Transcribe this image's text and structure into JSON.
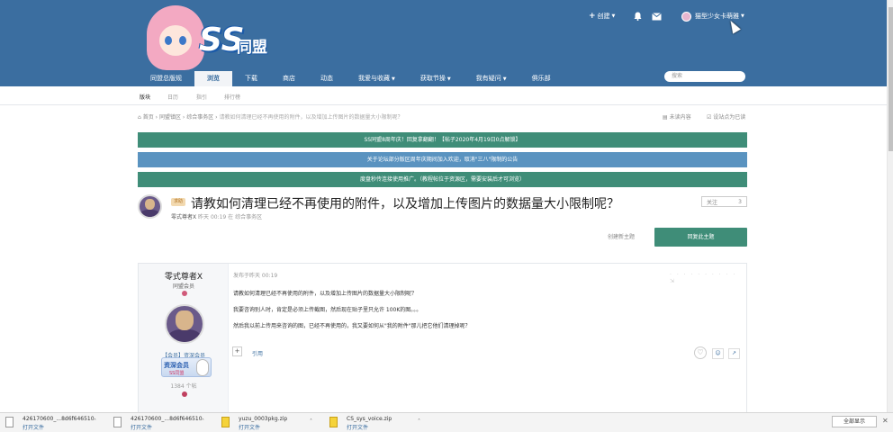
{
  "header": {
    "site_logo_text": "SS同盟",
    "create_label": "创建",
    "username": "猫型少女卡萌雅"
  },
  "nav": {
    "items": [
      {
        "label": "同盟总版规"
      },
      {
        "label": "浏览"
      },
      {
        "label": "下载"
      },
      {
        "label": "商店"
      },
      {
        "label": "动态"
      },
      {
        "label": "我爱与收藏"
      },
      {
        "label": "获取节操"
      },
      {
        "label": "我有疑问"
      },
      {
        "label": "俱乐部"
      }
    ],
    "search_placeholder": "搜索"
  },
  "subnav": {
    "items": [
      "版块",
      "日历",
      "指引",
      "排行榜"
    ]
  },
  "breadcrumb": {
    "home": "首页",
    "level1": "同盟镇区",
    "level2": "综合事务区",
    "current": "请教如何清理已经不再使用的附件，以及增加上传图片的数据量大小限制呢？",
    "unread": "未读内容",
    "mark_read": "设站点为已读"
  },
  "banners": [
    {
      "text": "SS同盟8周年庆！回复拿翻翻！【帖子2020年4月19日0点解锁】",
      "color": "#3f8d78"
    },
    {
      "text": "关于论坛部分版区周年庆期间加入欢迎，取消\"三八\"限制的公告",
      "color": "#5a93c0"
    },
    {
      "text": "度盘秒传连接使用推广。（教程帖位于资源区，需要安装后才可浏览）",
      "color": "#3f8d78"
    }
  ],
  "topic": {
    "tag": "求助",
    "title": "请教如何清理已经不再使用的附件，以及增加上传图片的数据量大小限制呢？",
    "author": "零式尊者X",
    "time": "昨天 00:19",
    "in_label": "在",
    "forum": "综合事务区",
    "follow_label": "关注",
    "follow_count": "3",
    "new_topic": "创建新主题",
    "reply": "回复此主题"
  },
  "post": {
    "author": "零式尊者X",
    "group": "同盟会员",
    "rank": "【会员】资深会员",
    "badge_title": "资深会员",
    "badge_sub": "SS同盟",
    "post_count": "1384 个帖",
    "posted": "发布于昨天 00:19",
    "lines": [
      "请教如何清理已经不再使用的附件，以及增加上传图片的数据量大小限制呢？",
      "我要咨询别人时，肯定是必须上传截图，然后现在贴子里只允许 100K的图。。。",
      "然后我以前上传用来咨询的图，已经不再使用的，我又要如何从\"我的附件\"那儿把它他们清理掉呢？"
    ],
    "quote_label": "引用"
  },
  "downloads": {
    "items": [
      {
        "name": "426170600_...8d6f646510",
        "action": "打开文件"
      },
      {
        "name": "426170600_...8d6f646510",
        "action": "打开文件"
      },
      {
        "name": "yuzu_0003pkg.zip",
        "action": "打开文件"
      },
      {
        "name": "CS_sys_voice.zip",
        "action": "打开文件"
      }
    ],
    "show_all": "全部显示"
  }
}
